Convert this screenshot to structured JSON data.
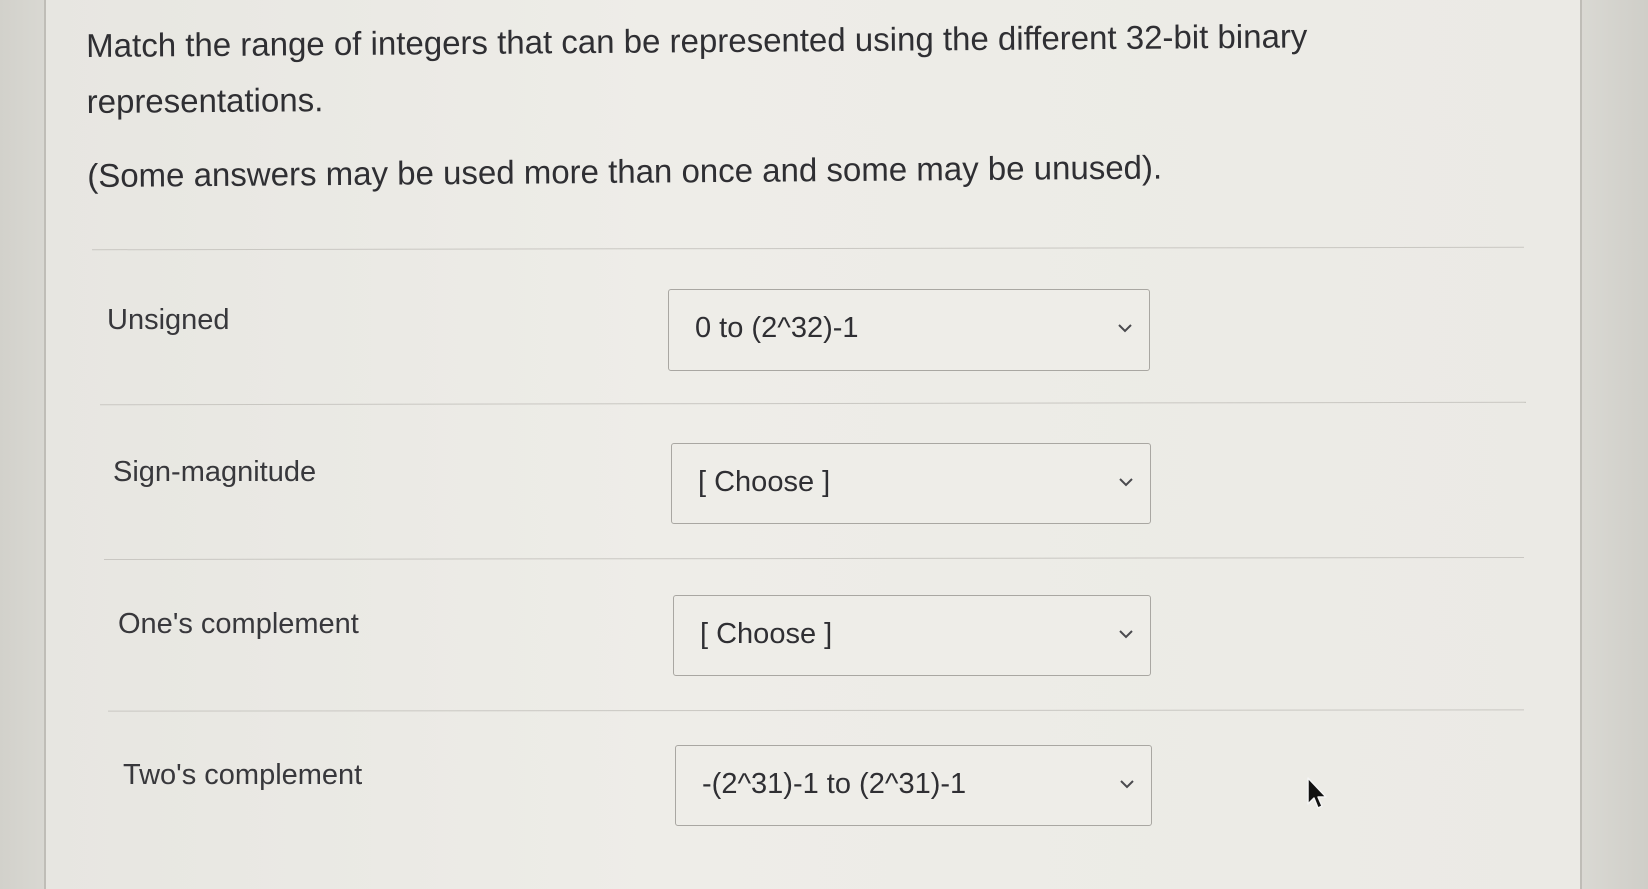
{
  "question": {
    "line1": "Match the range of integers that can be represented using the different 32-bit binary",
    "line2": "representations.",
    "note": "(Some answers may be used more than once and some may be unused)."
  },
  "rows": [
    {
      "label": "Unsigned",
      "selected": "0 to (2^32)-1"
    },
    {
      "label": "Sign-magnitude",
      "selected": "[ Choose ]"
    },
    {
      "label": "One's complement",
      "selected": "[ Choose ]"
    },
    {
      "label": "Two's complement",
      "selected": "-(2^31)-1 to (2^31)-1"
    }
  ],
  "icons": {
    "dropdown": "chevron-down-icon",
    "cursor": "mouse-pointer-icon"
  }
}
